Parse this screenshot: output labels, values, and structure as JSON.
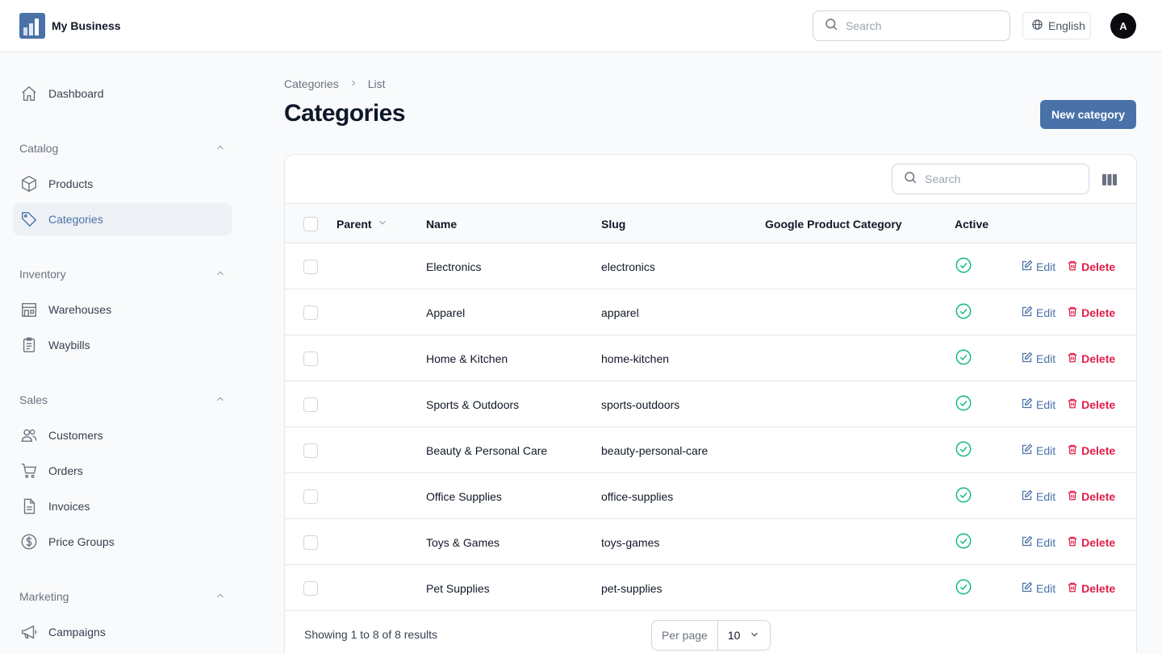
{
  "brand": {
    "name": "My Business"
  },
  "topbar": {
    "search_placeholder": "Search",
    "language": "English",
    "avatar_initial": "A"
  },
  "sidebar": {
    "dashboard": "Dashboard",
    "groups": {
      "catalog": {
        "label": "Catalog",
        "items": [
          "Products",
          "Categories"
        ]
      },
      "inventory": {
        "label": "Inventory",
        "items": [
          "Warehouses",
          "Waybills"
        ]
      },
      "sales": {
        "label": "Sales",
        "items": [
          "Customers",
          "Orders",
          "Invoices",
          "Price Groups"
        ]
      },
      "marketing": {
        "label": "Marketing",
        "items": [
          "Campaigns"
        ]
      }
    },
    "active_item": "Categories"
  },
  "breadcrumb": {
    "parent": "Categories",
    "current": "List"
  },
  "page": {
    "title": "Categories",
    "new_button": "New category"
  },
  "table": {
    "search_placeholder": "Search",
    "columns": {
      "parent": "Parent",
      "name": "Name",
      "slug": "Slug",
      "google_category": "Google Product Category",
      "active": "Active"
    },
    "actions": {
      "edit": "Edit",
      "delete": "Delete"
    },
    "rows": [
      {
        "parent": "",
        "name": "Electronics",
        "slug": "electronics",
        "google_category": "",
        "active": true
      },
      {
        "parent": "",
        "name": "Apparel",
        "slug": "apparel",
        "google_category": "",
        "active": true
      },
      {
        "parent": "",
        "name": "Home & Kitchen",
        "slug": "home-kitchen",
        "google_category": "",
        "active": true
      },
      {
        "parent": "",
        "name": "Sports & Outdoors",
        "slug": "sports-outdoors",
        "google_category": "",
        "active": true
      },
      {
        "parent": "",
        "name": "Beauty & Personal Care",
        "slug": "beauty-personal-care",
        "google_category": "",
        "active": true
      },
      {
        "parent": "",
        "name": "Office Supplies",
        "slug": "office-supplies",
        "google_category": "",
        "active": true
      },
      {
        "parent": "",
        "name": "Toys & Games",
        "slug": "toys-games",
        "google_category": "",
        "active": true
      },
      {
        "parent": "",
        "name": "Pet Supplies",
        "slug": "pet-supplies",
        "google_category": "",
        "active": true
      }
    ],
    "footer": {
      "showing": "Showing 1 to 8 of 8 results",
      "per_page_label": "Per page",
      "per_page_value": "10"
    }
  },
  "colors": {
    "primary": "#4a72a8",
    "danger": "#e11d48",
    "success": "#10b981",
    "active_nav_bg": "#eef1f5"
  }
}
